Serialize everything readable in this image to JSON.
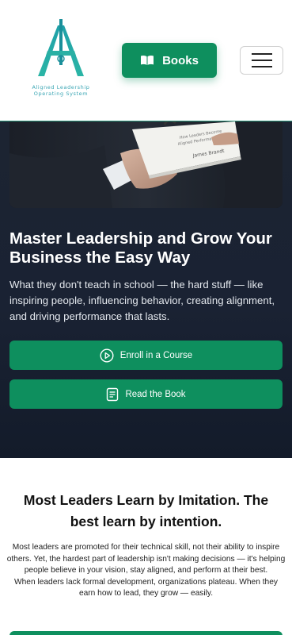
{
  "header": {
    "logo_line1": "Aligned Leadership",
    "logo_line2": "Operating System",
    "books_label": "Books",
    "menu_icon": "hamburger-icon",
    "book_icon": "open-book-icon"
  },
  "hero": {
    "title": "Master Leadership and Grow Your Business the Easy Way",
    "subtitle": "What they don't teach in school — the hard stuff — like inspiring people, influencing behavior, creating alignment, and driving performance that lasts.",
    "enroll_label": "Enroll in a Course",
    "read_label": "Read the Book",
    "enroll_icon": "play-circle-icon",
    "read_icon": "document-icon"
  },
  "intro": {
    "title": "Most Leaders Learn by Imitation. The best learn by intention.",
    "paragraph1": "Most leaders are promoted for their technical skill, not their ability to inspire others. Yet, the hardest part of leadership isn't making decisions — it's helping people believe in your vision, stay aligned, and perform at their best.",
    "paragraph2": "When leaders lack formal development, organizations plateau. When they earn how to lead, they grow — easily."
  },
  "colors": {
    "accent": "#0e8f5e",
    "hero_bg": "#1c2432",
    "logo_teal": "#2ba3a8"
  }
}
